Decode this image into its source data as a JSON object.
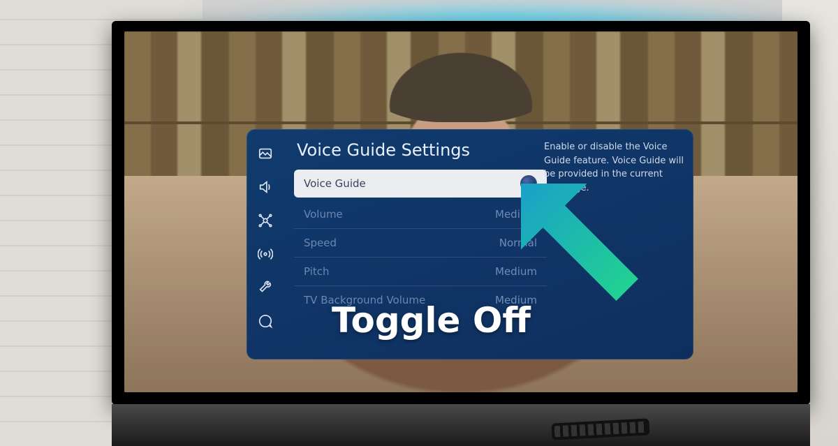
{
  "panel": {
    "title": "Voice Guide Settings",
    "help": "Enable or disable the Voice Guide feature. Voice Guide will be provided in the current language.",
    "rows": [
      {
        "label": "Voice Guide",
        "value": ""
      },
      {
        "label": "Volume",
        "value": "Medium"
      },
      {
        "label": "Speed",
        "value": "Normal"
      },
      {
        "label": "Pitch",
        "value": "Medium"
      },
      {
        "label": "TV Background Volume",
        "value": "Medium"
      }
    ]
  },
  "sidebar_icons": [
    "picture-icon",
    "sound-icon",
    "network-icon",
    "broadcast-icon",
    "system-icon",
    "support-icon"
  ],
  "annotation": {
    "label": "Toggle Off"
  }
}
